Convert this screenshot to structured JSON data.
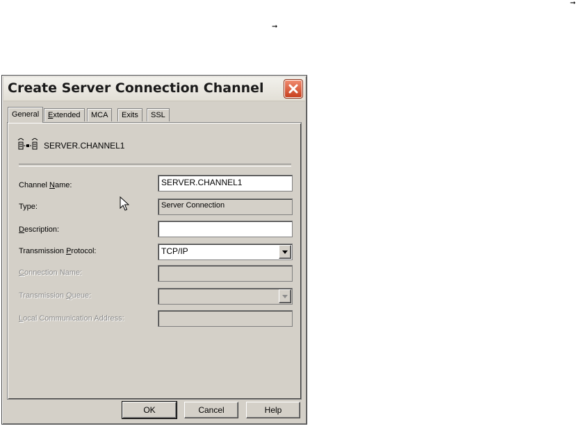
{
  "decor": {
    "arrow_glyph": "➞"
  },
  "dialog": {
    "title": "Create Server Connection Channel",
    "tabs": [
      {
        "label": "General",
        "active": true
      },
      {
        "label": "Extended",
        "underline": "E",
        "rest": "xtended"
      },
      {
        "label": "MCA"
      },
      {
        "label": "Exits"
      },
      {
        "label": "SSL"
      }
    ],
    "header_label": "SERVER.CHANNEL1",
    "fields": {
      "channel_name": {
        "label_pre": "Channel ",
        "label_ul": "N",
        "label_post": "ame:",
        "value": "SERVER.CHANNEL1"
      },
      "type": {
        "label": "Type:",
        "value": "Server Connection"
      },
      "description": {
        "label_ul": "D",
        "label_post": "escription:",
        "value": ""
      },
      "transmission_protocol": {
        "label_pre": "Transmission ",
        "label_ul": "P",
        "label_post": "rotocol:",
        "value": "TCP/IP"
      },
      "connection_name": {
        "label_ul": "C",
        "label_post": "onnection Name:",
        "value": ""
      },
      "transmission_queue": {
        "label_pre": "Transmission ",
        "label_ul": "Q",
        "label_post": "ueue:",
        "value": ""
      },
      "local_comm_address": {
        "label_ul": "L",
        "label_post": "ocal Communication Address:",
        "value": ""
      }
    },
    "buttons": {
      "ok": "OK",
      "cancel": "Cancel",
      "help": "Help"
    }
  },
  "icons": {
    "close": "close-icon",
    "channel": "channel-icon",
    "dropdown": "chevron-down-icon",
    "cursor": "mouse-pointer-icon"
  }
}
